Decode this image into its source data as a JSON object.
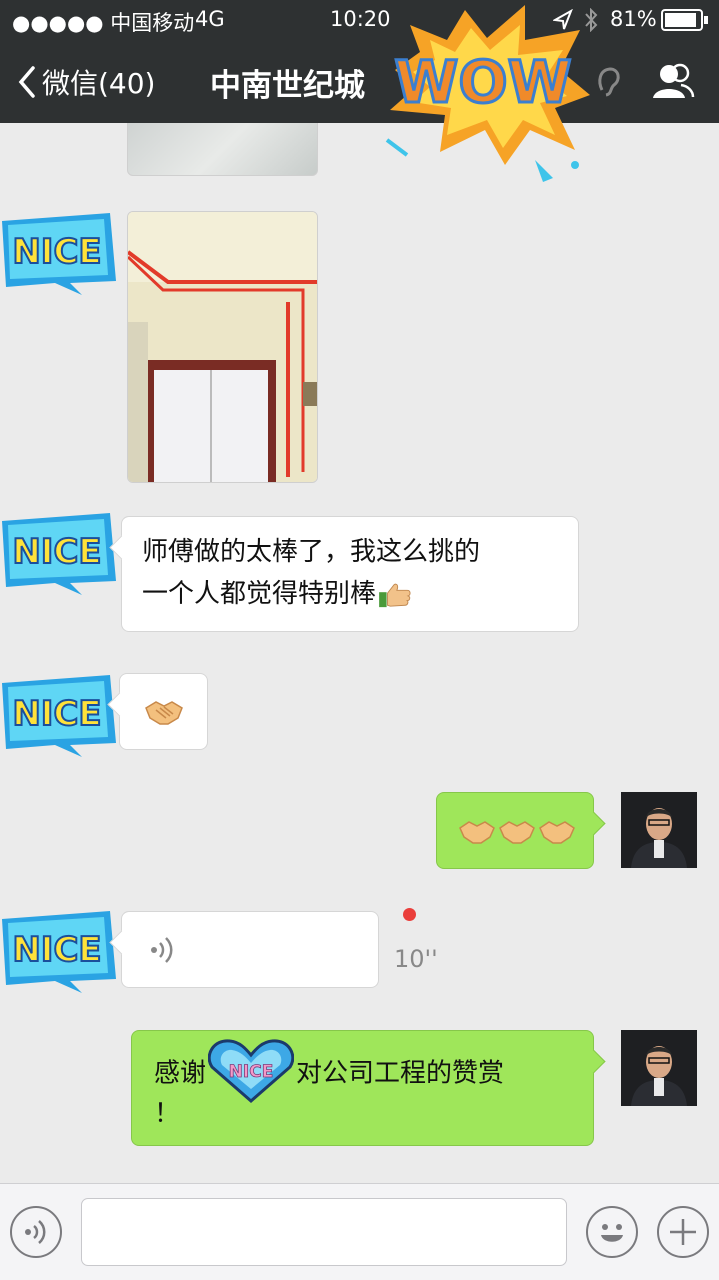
{
  "status_bar": {
    "carrier": "●●●●● 中国移动",
    "network": "4G",
    "time": "10:20",
    "battery_percent": "81%"
  },
  "nav": {
    "back_label": "微信(40)",
    "title": "中南世纪城"
  },
  "stickers": {
    "wow_text": "WOW",
    "nice_text": "NICE",
    "heart_text": "NICE"
  },
  "messages": [
    {
      "side": "in",
      "type": "image"
    },
    {
      "side": "in",
      "type": "image"
    },
    {
      "side": "in",
      "type": "text",
      "line1": "师傅做的太棒了，我这么挑的",
      "line2": "一个人都觉得特别棒",
      "emoji": "thumbs-up"
    },
    {
      "side": "in",
      "type": "emoji",
      "emoji": "handshake"
    },
    {
      "side": "out",
      "type": "emoji",
      "emoji": "handshake x3"
    },
    {
      "side": "in",
      "type": "voice",
      "duration": "10''"
    },
    {
      "side": "out",
      "type": "text",
      "before": "感谢",
      "after": "对公司工程的赞赏",
      "line2": "！"
    }
  ],
  "input": {
    "placeholder": ""
  },
  "colors": {
    "bar": "#2e3132",
    "chat_bg": "#ebebeb",
    "out_bubble": "#9fe65a",
    "unread_dot": "#ea3e3b"
  }
}
